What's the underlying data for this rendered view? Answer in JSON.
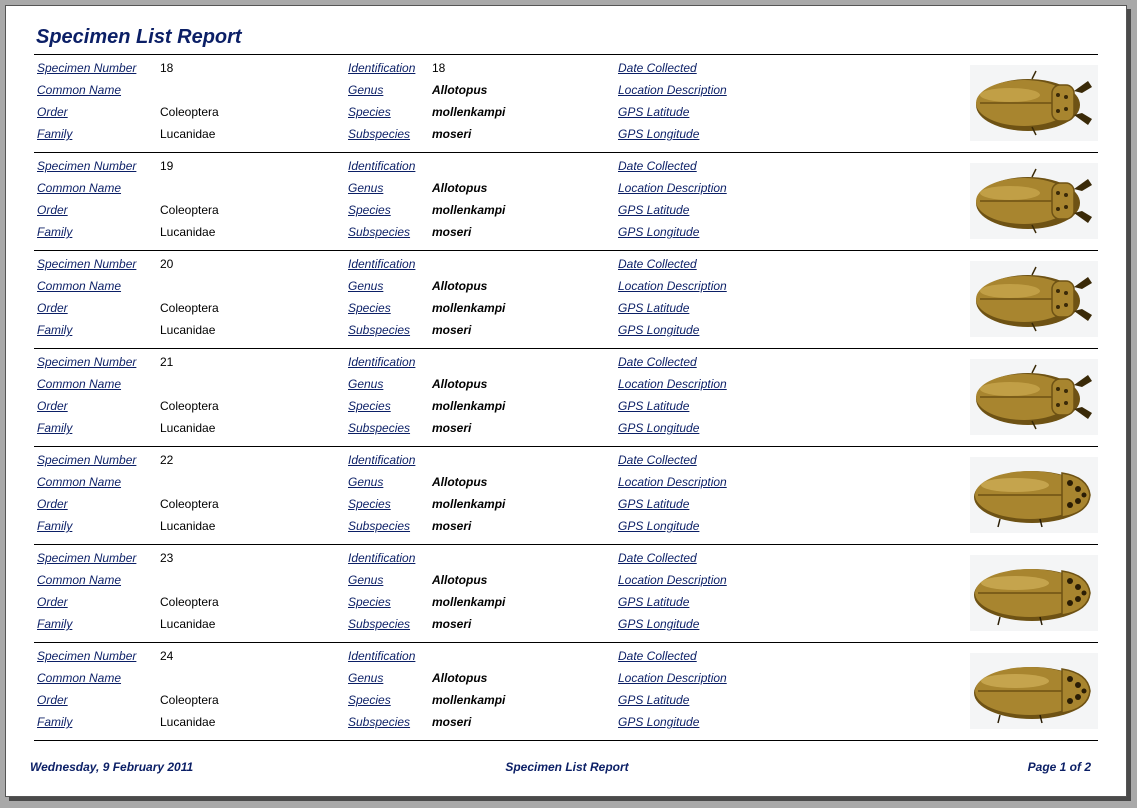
{
  "report": {
    "title": "Specimen List Report"
  },
  "labels": {
    "specimen_number": "Specimen Number",
    "common_name": "Common Name",
    "order": "Order",
    "family": "Family",
    "identification": "Identification",
    "genus": "Genus",
    "species": "Species",
    "subspecies": "Subspecies",
    "date_collected": "Date Collected",
    "location_description": "Location Description",
    "gps_latitude": "GPS Latitude",
    "gps_longitude": "GPS Longitude"
  },
  "records": [
    {
      "specimen_number": "18",
      "common_name": "",
      "order": "Coleoptera",
      "family": "Lucanidae",
      "identification": "18",
      "genus": "Allotopus",
      "species": "mollenkampi",
      "subspecies": "moseri",
      "date_collected": "",
      "location_description": "",
      "gps_latitude": "",
      "gps_longitude": "",
      "image": "stag-beetle-icon"
    },
    {
      "specimen_number": "19",
      "common_name": "",
      "order": "Coleoptera",
      "family": "Lucanidae",
      "identification": "",
      "genus": "Allotopus",
      "species": "mollenkampi",
      "subspecies": "moseri",
      "date_collected": "",
      "location_description": "",
      "gps_latitude": "",
      "gps_longitude": "",
      "image": "stag-beetle-icon"
    },
    {
      "specimen_number": "20",
      "common_name": "",
      "order": "Coleoptera",
      "family": "Lucanidae",
      "identification": "",
      "genus": "Allotopus",
      "species": "mollenkampi",
      "subspecies": "moseri",
      "date_collected": "",
      "location_description": "",
      "gps_latitude": "",
      "gps_longitude": "",
      "image": "stag-beetle-icon"
    },
    {
      "specimen_number": "21",
      "common_name": "",
      "order": "Coleoptera",
      "family": "Lucanidae",
      "identification": "",
      "genus": "Allotopus",
      "species": "mollenkampi",
      "subspecies": "moseri",
      "date_collected": "",
      "location_description": "",
      "gps_latitude": "",
      "gps_longitude": "",
      "image": "stag-beetle-icon"
    },
    {
      "specimen_number": "22",
      "common_name": "",
      "order": "Coleoptera",
      "family": "Lucanidae",
      "identification": "",
      "genus": "Allotopus",
      "species": "mollenkampi",
      "subspecies": "moseri",
      "date_collected": "",
      "location_description": "",
      "gps_latitude": "",
      "gps_longitude": "",
      "image": "scarab-beetle-icon"
    },
    {
      "specimen_number": "23",
      "common_name": "",
      "order": "Coleoptera",
      "family": "Lucanidae",
      "identification": "",
      "genus": "Allotopus",
      "species": "mollenkampi",
      "subspecies": "moseri",
      "date_collected": "",
      "location_description": "",
      "gps_latitude": "",
      "gps_longitude": "",
      "image": "scarab-beetle-icon"
    },
    {
      "specimen_number": "24",
      "common_name": "",
      "order": "Coleoptera",
      "family": "Lucanidae",
      "identification": "",
      "genus": "Allotopus",
      "species": "mollenkampi",
      "subspecies": "moseri",
      "date_collected": "",
      "location_description": "",
      "gps_latitude": "",
      "gps_longitude": "",
      "image": "scarab-beetle-icon"
    }
  ],
  "footer": {
    "date": "Wednesday, 9 February 2011",
    "title": "Specimen List Report",
    "page": "Page 1 of 2"
  },
  "colors": {
    "label_text": "#0b1f66",
    "beetle_body": "#a8852f",
    "beetle_shadow": "#6e5214"
  }
}
